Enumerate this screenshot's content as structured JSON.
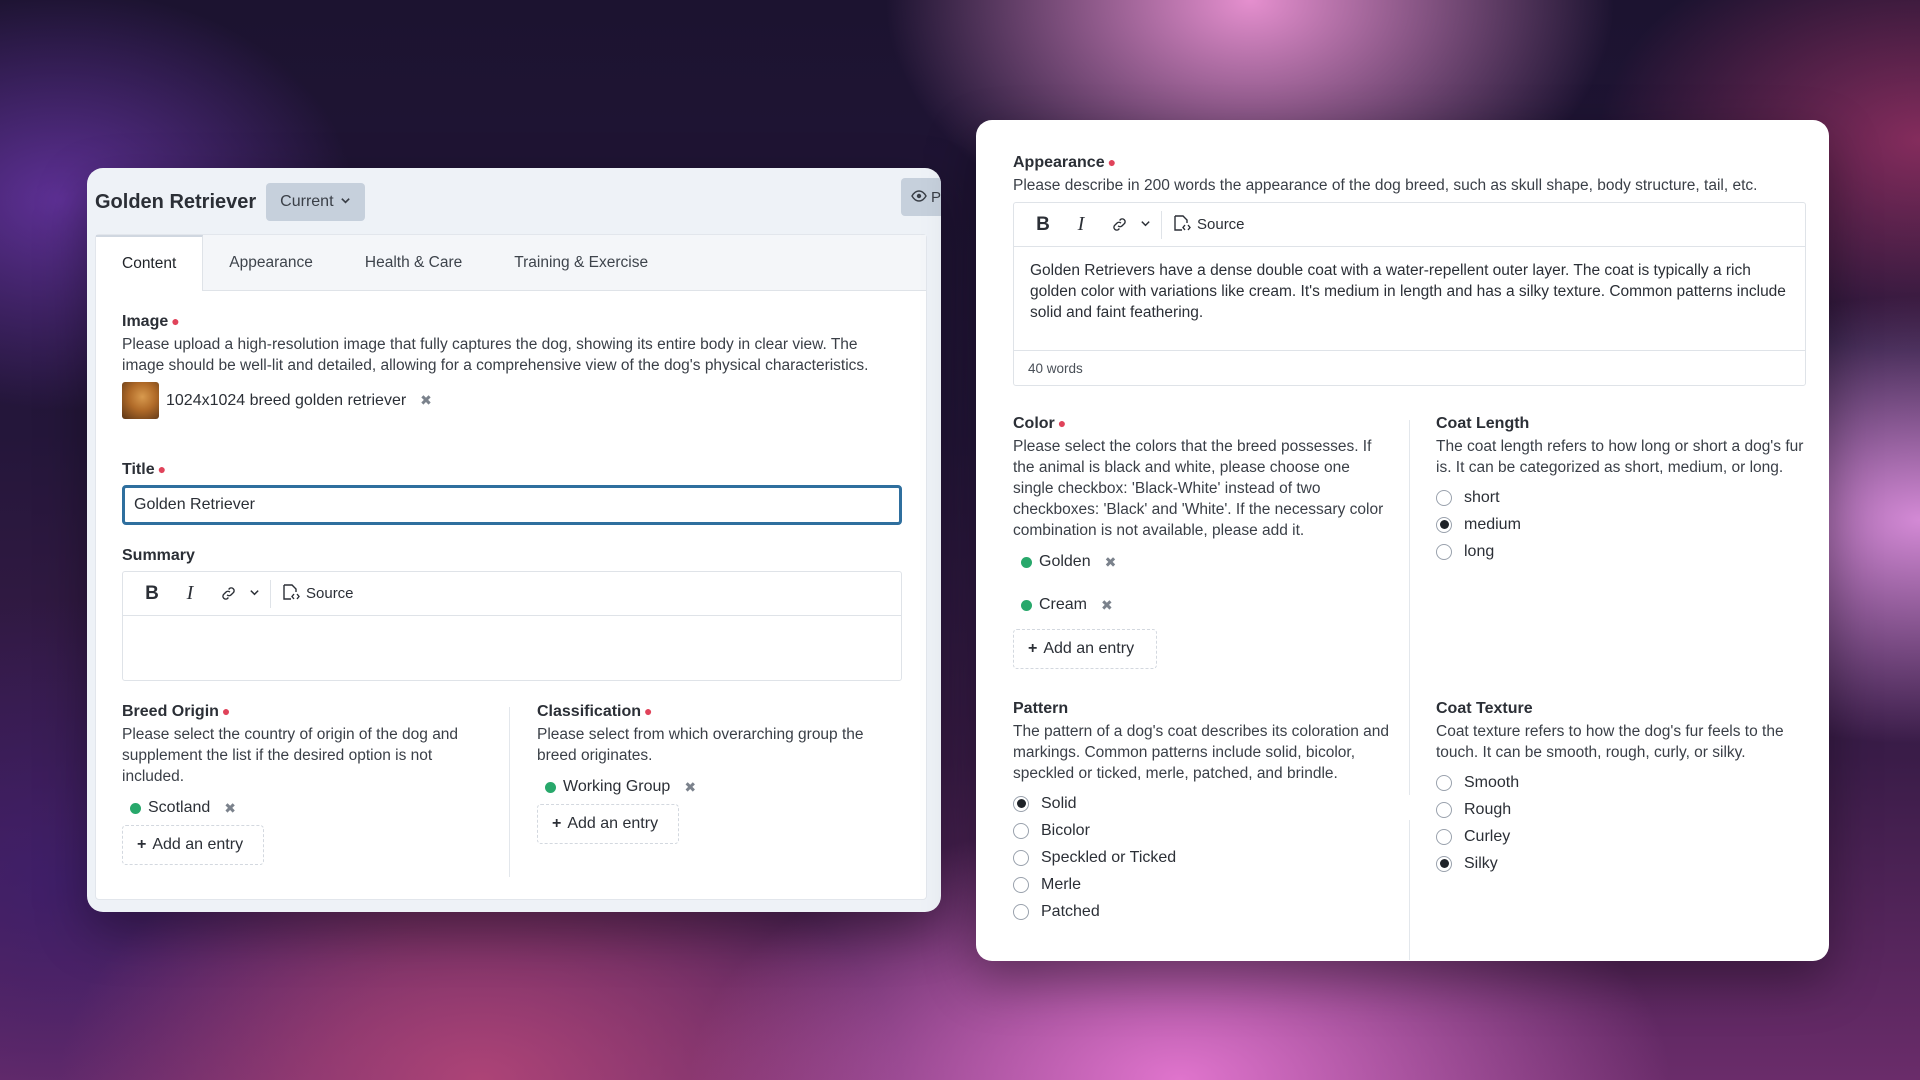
{
  "left": {
    "title": "Golden Retriever",
    "version": "Current",
    "preview_label": "P",
    "tabs": [
      "Content",
      "Appearance",
      "Health & Care",
      "Training & Exercise"
    ],
    "image": {
      "label": "Image",
      "desc": "Please upload a high-resolution image that fully captures the dog, showing its entire body in clear view. The image should be well-lit and detailed, allowing for a comprehensive view of the dog's physical characteristics.",
      "file": "1024x1024 breed golden retriever"
    },
    "title_field": {
      "label": "Title",
      "value": "Golden Retriever"
    },
    "summary": {
      "label": "Summary",
      "source": "Source"
    },
    "breed_origin": {
      "label": "Breed Origin",
      "desc": "Please select the country of origin of the dog and supplement the list if the desired option is not included.",
      "entry": "Scotland",
      "add": "Add an entry"
    },
    "classification": {
      "label": "Classification",
      "desc": "Please select from which overarching group the breed originates.",
      "entry": "Working Group",
      "add": "Add an entry"
    }
  },
  "right": {
    "appearance": {
      "label": "Appearance",
      "desc": "Please describe in 200 words the appearance of the dog breed, such as skull shape, body structure, tail, etc.",
      "source": "Source",
      "text": "Golden Retrievers have a dense double coat with a water-repellent outer layer. The coat is typically a rich golden color with variations like cream. It's medium in length and has a silky texture. Common patterns include solid and faint feathering.",
      "wordcount": "40 words"
    },
    "color": {
      "label": "Color",
      "desc": "Please select the colors that the breed possesses. If the animal is black and white, please choose one single checkbox: 'Black-White' instead of two checkboxes: 'Black' and 'White'. If the necessary color combination is not available, please add it.",
      "entries": [
        "Golden",
        "Cream"
      ],
      "add": "Add an entry"
    },
    "coat_length": {
      "label": "Coat Length",
      "desc": "The coat length refers to how long or short a dog's fur is. It can be categorized as short, medium, or long.",
      "options": [
        "short",
        "medium",
        "long"
      ],
      "selected": "medium"
    },
    "pattern": {
      "label": "Pattern",
      "desc": "The pattern of a dog's coat describes its coloration and markings. Common patterns include solid, bicolor, speckled or ticked, merle, patched, and brindle.",
      "options": [
        "Solid",
        "Bicolor",
        "Speckled or Ticked",
        "Merle",
        "Patched"
      ],
      "selected": "Solid"
    },
    "coat_texture": {
      "label": "Coat Texture",
      "desc": "Coat texture refers to how the dog's fur feels to the touch. It can be smooth, rough, curly, or silky.",
      "options": [
        "Smooth",
        "Rough",
        "Curley",
        "Silky"
      ],
      "selected": "Silky"
    }
  },
  "colors": {
    "accent": "#2f6f9e",
    "required": "#e0435a",
    "chip_dot": "#28a86b"
  }
}
